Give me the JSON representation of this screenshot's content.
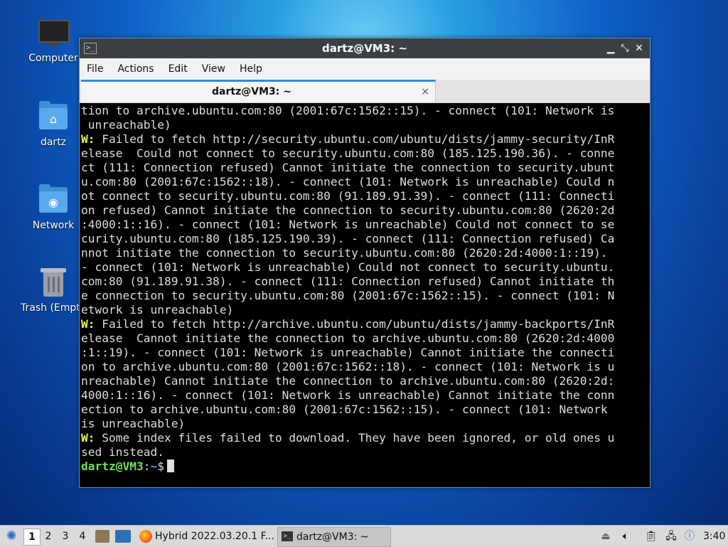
{
  "desktop": {
    "icons": [
      {
        "label": "Computer"
      },
      {
        "label": "dartz"
      },
      {
        "label": "Network"
      },
      {
        "label": "Trash (Empty)"
      }
    ]
  },
  "window": {
    "title": "dartz@VM3: ~",
    "menu": [
      "File",
      "Actions",
      "Edit",
      "View",
      "Help"
    ],
    "tab_title": "dartz@VM3: ~",
    "tab_close": "×",
    "controls": {
      "minimize": "▁",
      "maximize": "⤡",
      "close": "✕"
    }
  },
  "terminal": {
    "lines": [
      {
        "text": "tion to archive.ubuntu.com:80 (2001:67c:1562::15). - connect (101: Network is"
      },
      {
        "text": " unreachable)"
      },
      {
        "warn": "W:",
        "text": " Failed to fetch http://security.ubuntu.com/ubuntu/dists/jammy-security/InR"
      },
      {
        "text": "elease  Could not connect to security.ubuntu.com:80 (185.125.190.36). - conne"
      },
      {
        "text": "ct (111: Connection refused) Cannot initiate the connection to security.ubunt"
      },
      {
        "text": "u.com:80 (2001:67c:1562::18). - connect (101: Network is unreachable) Could n"
      },
      {
        "text": "ot connect to security.ubuntu.com:80 (91.189.91.39). - connect (111: Connecti"
      },
      {
        "text": "on refused) Cannot initiate the connection to security.ubuntu.com:80 (2620:2d"
      },
      {
        "text": ":4000:1::16). - connect (101: Network is unreachable) Could not connect to se"
      },
      {
        "text": "curity.ubuntu.com:80 (185.125.190.39). - connect (111: Connection refused) Ca"
      },
      {
        "text": "nnot initiate the connection to security.ubuntu.com:80 (2620:2d:4000:1::19)."
      },
      {
        "text": "- connect (101: Network is unreachable) Could not connect to security.ubuntu."
      },
      {
        "text": "com:80 (91.189.91.38). - connect (111: Connection refused) Cannot initiate th"
      },
      {
        "text": "e connection to security.ubuntu.com:80 (2001:67c:1562::15). - connect (101: N"
      },
      {
        "text": "etwork is unreachable)"
      },
      {
        "warn": "W:",
        "text": " Failed to fetch http://archive.ubuntu.com/ubuntu/dists/jammy-backports/InR"
      },
      {
        "text": "elease  Cannot initiate the connection to archive.ubuntu.com:80 (2620:2d:4000"
      },
      {
        "text": ":1::19). - connect (101: Network is unreachable) Cannot initiate the connecti"
      },
      {
        "text": "on to archive.ubuntu.com:80 (2001:67c:1562::18). - connect (101: Network is u"
      },
      {
        "text": "nreachable) Cannot initiate the connection to archive.ubuntu.com:80 (2620:2d:"
      },
      {
        "text": "4000:1::16). - connect (101: Network is unreachable) Cannot initiate the conn"
      },
      {
        "text": "ection to archive.ubuntu.com:80 (2001:67c:1562::15). - connect (101: Network"
      },
      {
        "text": "is unreachable)"
      },
      {
        "warn": "W:",
        "text": " Some index files failed to download. They have been ignored, or old ones u"
      },
      {
        "text": "sed instead."
      }
    ],
    "prompt_user": "dartz@VM3",
    "prompt_sep": ":",
    "prompt_path": "~",
    "prompt_end": "$"
  },
  "taskbar": {
    "workspaces": [
      "1",
      "2",
      "3",
      "4"
    ],
    "active_workspace": "1",
    "tasks": [
      {
        "label": "Hybrid 2022.03.20.1 F...",
        "icon": "firefox-icon"
      },
      {
        "label": "dartz@VM3: ~",
        "icon": "terminal-icon"
      }
    ],
    "clock": "3:40"
  },
  "colors": {
    "warn": "#f0f050",
    "prompt_user": "#6ee05a",
    "prompt_path": "#5a9cf0",
    "tab_accent": "#3a88d8"
  }
}
